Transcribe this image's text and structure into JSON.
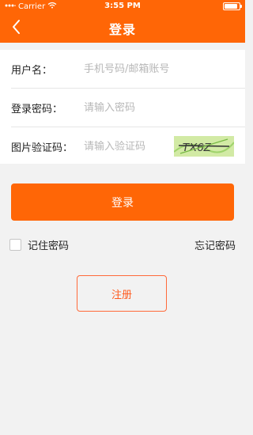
{
  "status_bar": {
    "carrier": "Carrier",
    "time": "3:55 PM"
  },
  "header": {
    "title": "登录"
  },
  "form": {
    "username_label": "用户名：",
    "username_placeholder": "手机号码/邮箱账号",
    "password_label": "登录密码：",
    "password_placeholder": "请输入密码",
    "captcha_label": "图片验证码：",
    "captcha_placeholder": "请输入验证码",
    "captcha_text": "TX6Z"
  },
  "actions": {
    "login_label": "登录",
    "remember_label": "记住密码",
    "forgot_label": "忘记密码",
    "register_label": "注册"
  },
  "colors": {
    "accent": "#ff6606",
    "background": "#f2f2f2"
  }
}
